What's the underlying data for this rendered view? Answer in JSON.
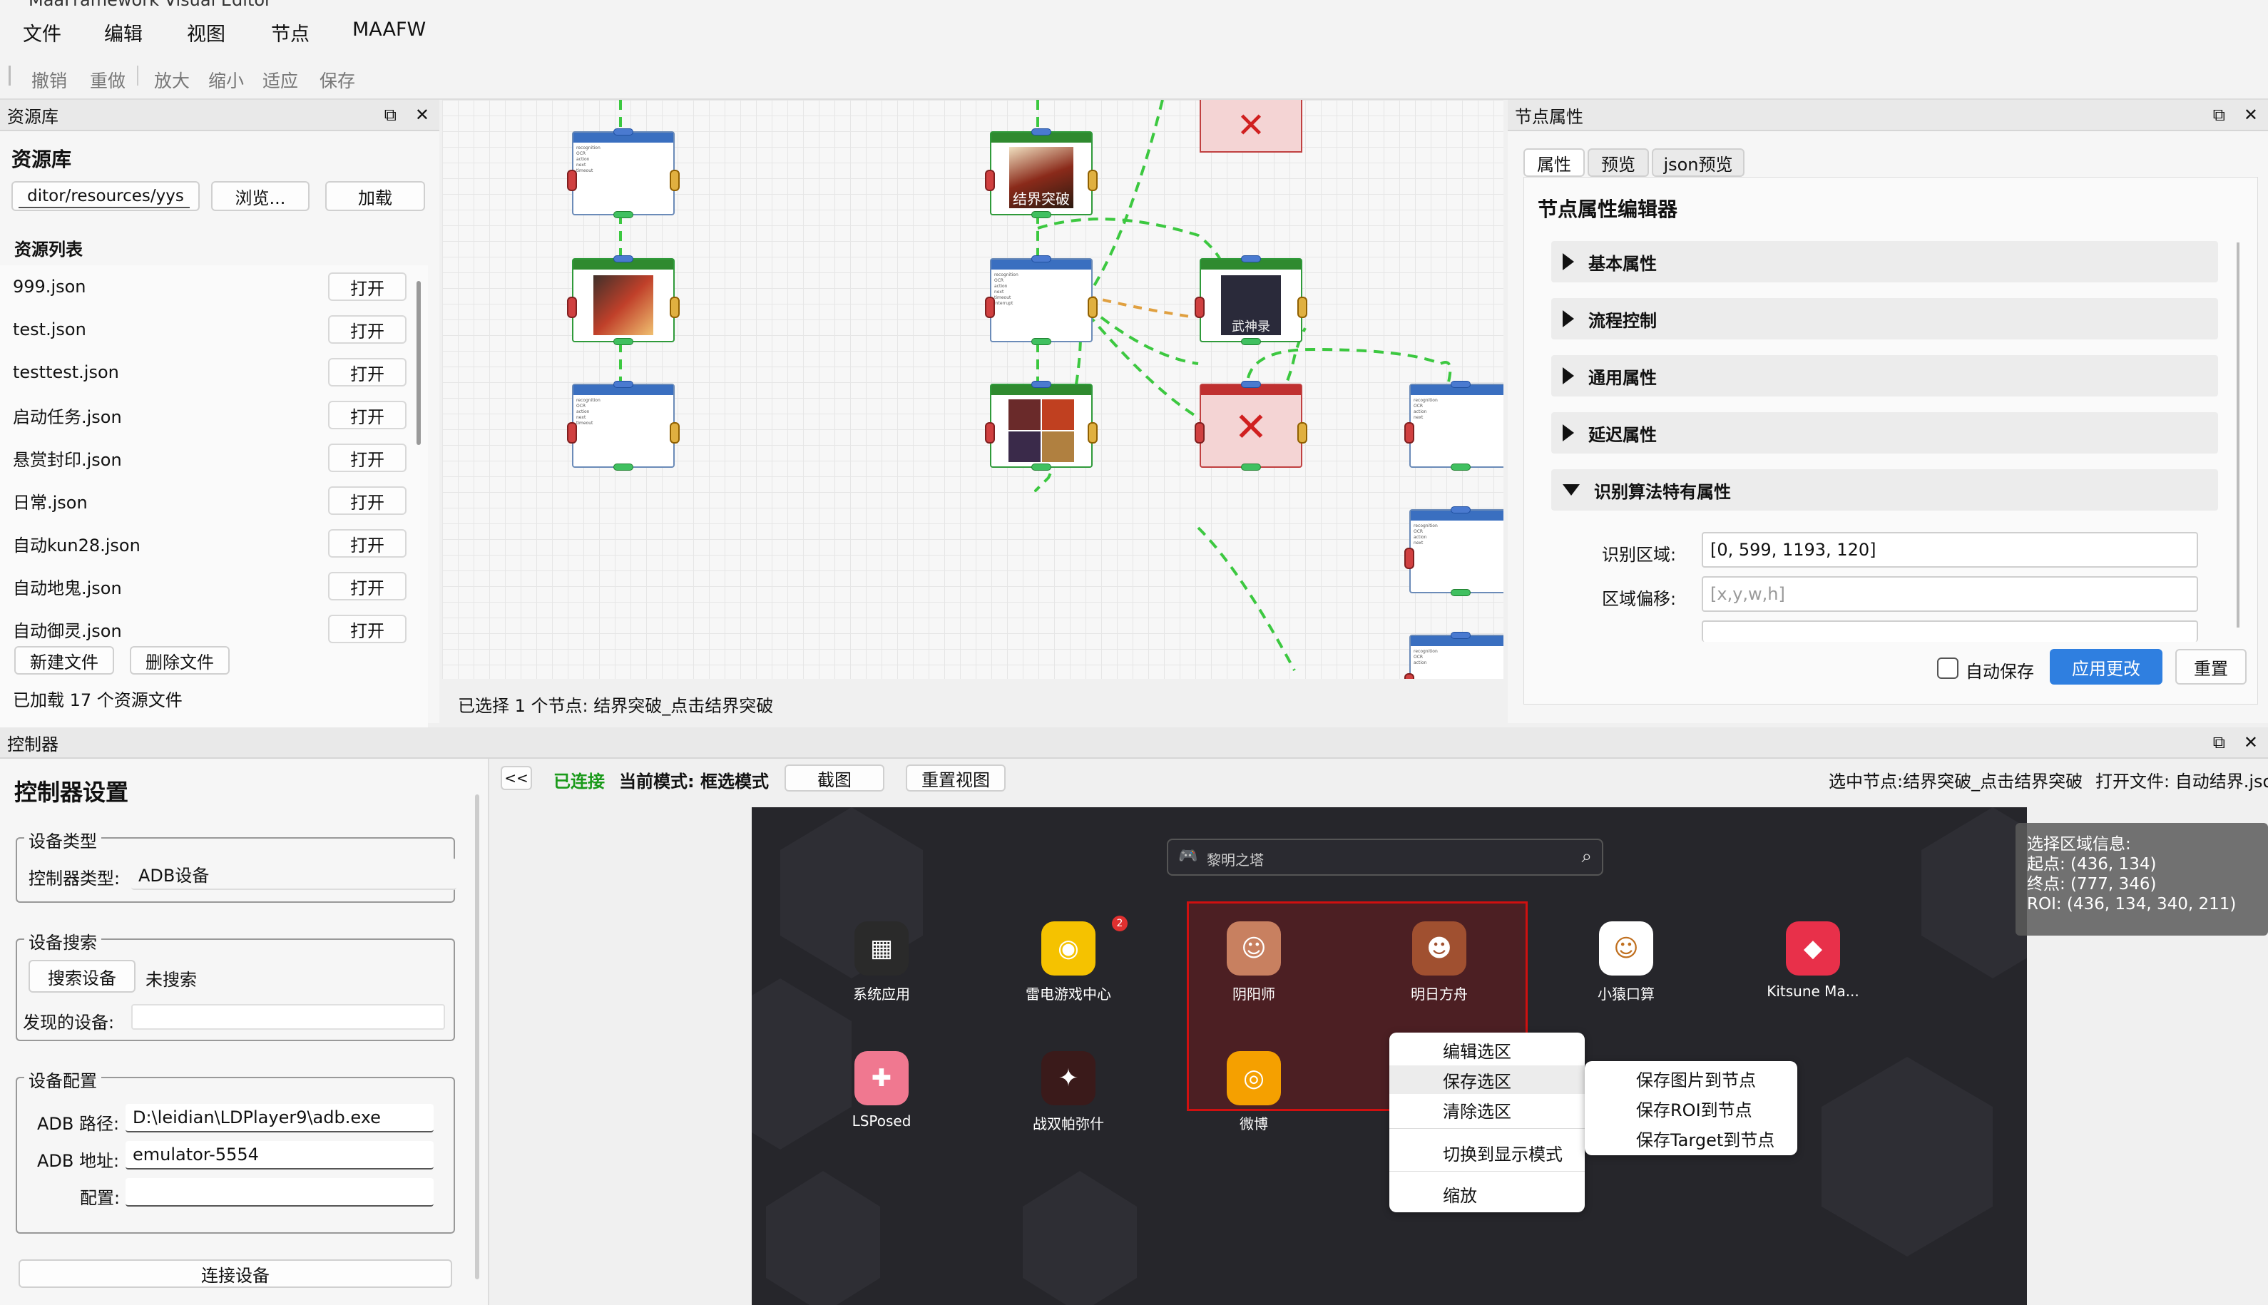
{
  "window": {
    "title": "MaaFramework Visual Editor"
  },
  "menubar": [
    "文件",
    "编辑",
    "视图",
    "节点",
    "MAAFW"
  ],
  "toolbar": [
    "撤销",
    "重做",
    "放大",
    "缩小",
    "适应",
    "保存"
  ],
  "resource_panel": {
    "dock_title": "资源库",
    "heading": "资源库",
    "path": "ditor/resources/yys",
    "browse": "浏览...",
    "load": "加载",
    "list_title": "资源列表",
    "open_label": "打开",
    "files": [
      "999.json",
      "test.json",
      "testtest.json",
      "启动任务.json",
      "悬赏封印.json",
      "日常.json",
      "自动kun28.json",
      "自动地鬼.json",
      "自动御灵.json"
    ],
    "new_file": "新建文件",
    "delete_file": "删除文件",
    "status": "已加载 17 个资源文件"
  },
  "canvas": {
    "status": "已选择 1 个节点: 结界突破_点击结界突破",
    "node_image_texts": [
      "结界突破",
      "武神录"
    ]
  },
  "node_props": {
    "dock_title": "节点属性",
    "tabs": [
      "属性",
      "预览",
      "json预览"
    ],
    "heading": "节点属性编辑器",
    "sections": [
      "基本属性",
      "流程控制",
      "通用属性",
      "延迟属性",
      "识别算法特有属性"
    ],
    "roi_label": "识别区域:",
    "roi_value": "[0, 599, 1193, 120]",
    "offset_label": "区域偏移:",
    "offset_placeholder": "[x,y,w,h]",
    "auto_save": "自动保存",
    "apply": "应用更改",
    "reset": "重置"
  },
  "controller": {
    "dock_title": "控制器",
    "heading": "控制器设置",
    "device_type_group": "设备类型",
    "controller_type_label": "控制器类型:",
    "controller_type_value": "ADB设备",
    "search_group": "设备搜索",
    "search_button": "搜索设备",
    "search_status": "未搜索",
    "found_label": "发现的设备:",
    "config_group": "设备配置",
    "adb_path_label": "ADB 路径:",
    "adb_path_value": "D:\\leidian\\LDPlayer9\\adb.exe",
    "adb_addr_label": "ADB 地址:",
    "adb_addr_value": "emulator-5554",
    "config_label": "配置:",
    "connect_button": "连接设备"
  },
  "screen_toolbar": {
    "collapse": "<<",
    "connected": "已连接",
    "mode": "当前模式: 框选模式",
    "screenshot": "截图",
    "reset_view": "重置视图",
    "selected_node": "选中节点:结界突破_点击结界突破",
    "open_file": "打开文件: 自动结界.jso"
  },
  "emulator": {
    "search_placeholder": "黎明之塔",
    "apps": [
      {
        "label": "系统应用",
        "color": "#2a2a2a",
        "glyph": "▦"
      },
      {
        "label": "雷电游戏中心",
        "color": "#f5c200",
        "glyph": "◉",
        "badge": "2"
      },
      {
        "label": "阴阳师",
        "color": "#c88060",
        "glyph": "☺"
      },
      {
        "label": "明日方舟",
        "color": "#a05030",
        "glyph": "☻"
      },
      {
        "label": "小猿口算",
        "color": "#ffffff",
        "glyph": "☺"
      },
      {
        "label": "Kitsune Ma...",
        "color": "#e8304a",
        "glyph": "◆"
      },
      {
        "label": "LSPosed",
        "color": "#f07890",
        "glyph": "✚"
      },
      {
        "label": "战双帕弥什",
        "color": "#3a1a1a",
        "glyph": "✦"
      },
      {
        "label": "微博",
        "color": "#f5a000",
        "glyph": "◎"
      }
    ]
  },
  "selection_info": {
    "title": "选择区域信息:",
    "start": "起点: (436, 134)",
    "end": "终点: (777, 346)",
    "roi": "ROI: (436, 134, 340, 211)"
  },
  "context_menu": [
    "编辑选区",
    "保存选区",
    "清除选区",
    "切换到显示模式",
    "缩放"
  ],
  "submenu": [
    "保存图片到节点",
    "保存ROI到节点",
    "保存Target到节点"
  ]
}
